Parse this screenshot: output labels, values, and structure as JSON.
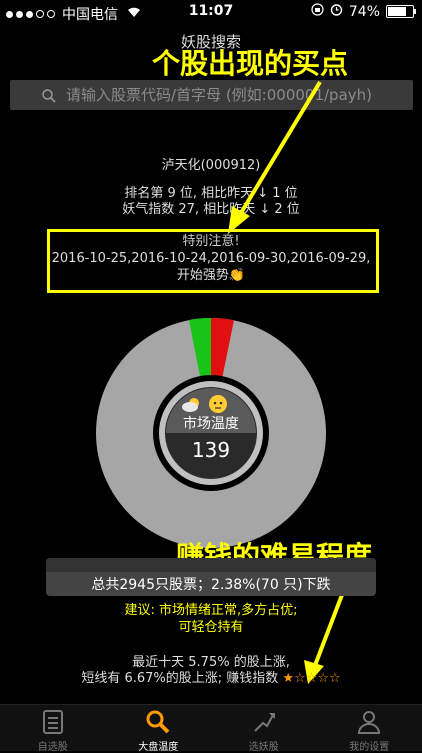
{
  "status_bar": {
    "carrier": "中国电信",
    "time": "11:07",
    "battery": "74%",
    "battery_level": 0.74
  },
  "nav": {
    "title": "妖股搜索"
  },
  "search": {
    "placeholder": "请输入股票代码/首字母 (例如:000001/payh)"
  },
  "stock": {
    "name_line": "泸天化(000912)",
    "rank_line": "排名第 9 位, 相比昨天 ↓ 1 位",
    "index_line": "妖气指数 27, 相比昨天 ↓ 2 位"
  },
  "notice": {
    "title": "特别注意!",
    "dates": "2016-10-25,2016-10-24,2016-09-30,2016-09-29,",
    "suffix": "开始强势👏"
  },
  "annotations": {
    "buy_point": "个股出现的买点",
    "difficulty": "赚钱的难易程度"
  },
  "gauge": {
    "label": "市场温度",
    "value": "139",
    "colors": {
      "green": "#18c418",
      "red": "#e01010",
      "gray": "#a6a6a6"
    }
  },
  "summary": {
    "text": "总共2945只股票；2.38%(70 只)下跌"
  },
  "advice": {
    "line1": "建议: 市场情绪正常,多方占优;",
    "line2": "可轻仓持有"
  },
  "stats": {
    "line1": "最近十天 5.75% 的股上涨,",
    "line2": "短线有 6.67%的股上涨; 赚钱指数",
    "stars": "★☆☆☆☆",
    "rating": 1,
    "rating_max": 5
  },
  "tabs": [
    {
      "label": "自选股",
      "icon": "list-icon",
      "active": false
    },
    {
      "label": "大盘温度",
      "icon": "search-icon",
      "active": true
    },
    {
      "label": "选妖股",
      "icon": "arrow-up-icon",
      "active": false
    },
    {
      "label": "我的设置",
      "icon": "person-icon",
      "active": false
    }
  ]
}
